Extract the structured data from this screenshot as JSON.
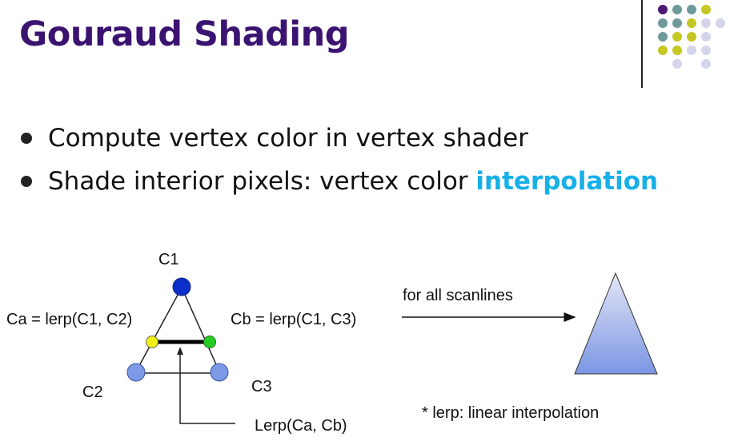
{
  "slide": {
    "title": "Gouraud Shading",
    "bullets": [
      {
        "text": "Compute vertex color in vertex shader",
        "highlight": ""
      },
      {
        "text": "Shade interior pixels: vertex color ",
        "highlight": "interpolation"
      }
    ]
  },
  "diagram": {
    "labels": {
      "c1": "C1",
      "c2": "C2",
      "c3": "C3",
      "ca": "Ca = lerp(C1, C2)",
      "cb": "Cb = lerp(C1, C3)",
      "lerp_ab": "Lerp(Ca, Cb)",
      "scanlines": "for all scanlines",
      "note": "* lerp: linear interpolation"
    },
    "colors": {
      "c1": "#0a2fc8",
      "c2": "#7d9ae6",
      "c3": "#7d9ae6",
      "ca": "#f0f014",
      "cb": "#22cc22",
      "gradient_top": "#e4e6f6",
      "gradient_bottom": "#7b96e4"
    }
  },
  "decor": {
    "dot_colors": {
      "purple": "#4b1b74",
      "teal": "#6f9a9c",
      "yellow": "#c5c722",
      "lavender": "#d4d4ea"
    }
  }
}
